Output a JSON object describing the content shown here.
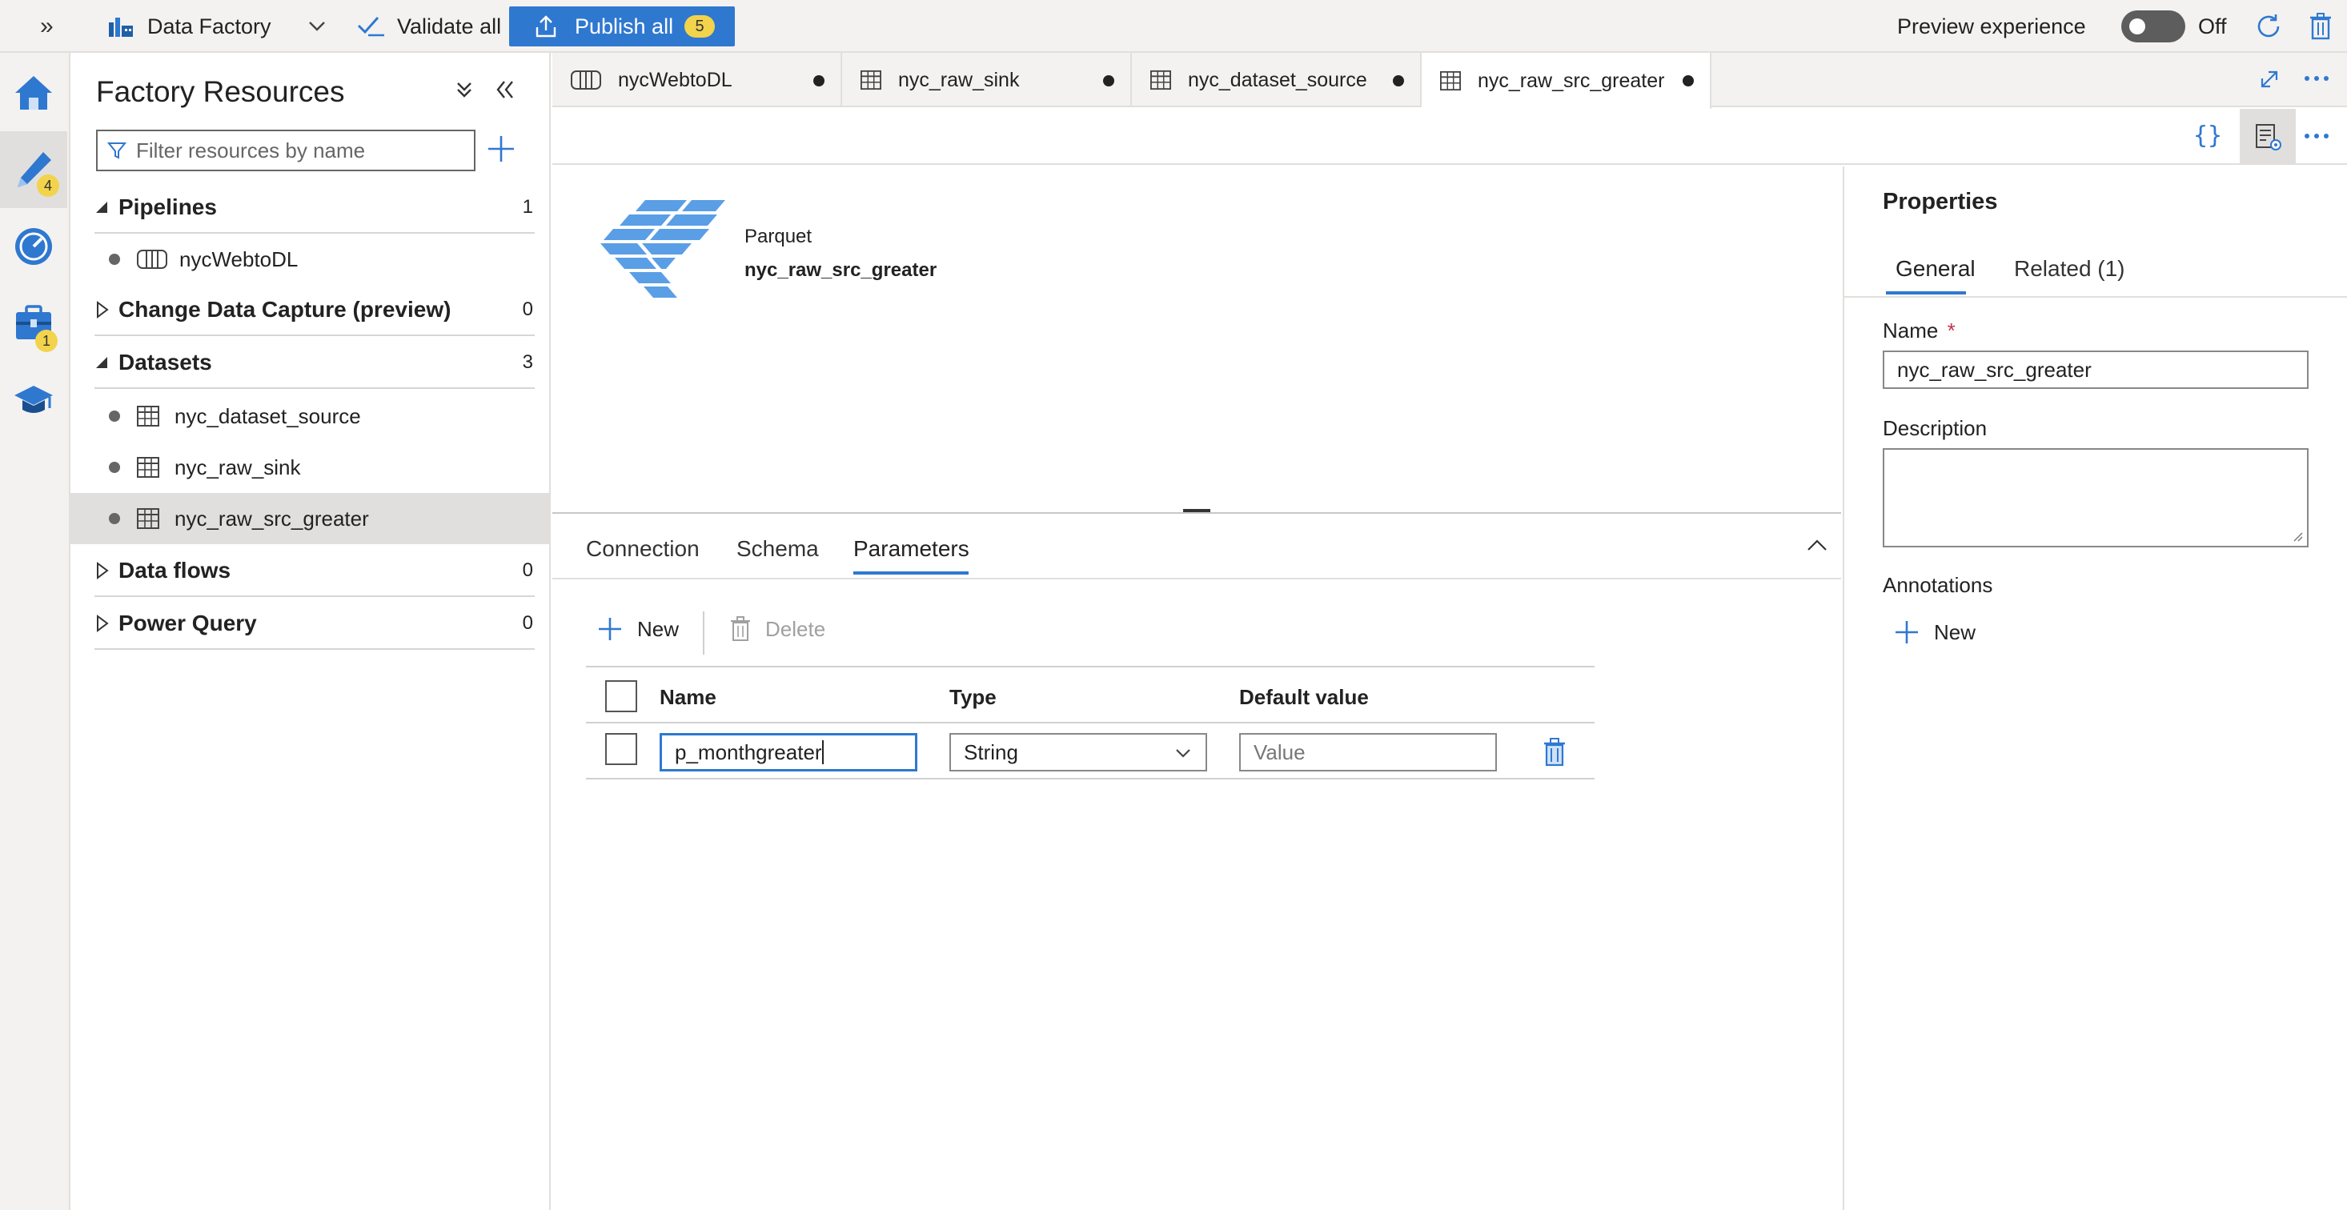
{
  "topbar": {
    "app_name": "Data Factory",
    "validate_label": "Validate all",
    "publish_label": "Publish all",
    "publish_count": "5",
    "preview_label": "Preview experience",
    "toggle_state": "Off"
  },
  "rail": {
    "author_badge": "4",
    "manage_badge": "1"
  },
  "resources": {
    "title": "Factory Resources",
    "filter_placeholder": "Filter resources by name",
    "sections": [
      {
        "label": "Pipelines",
        "count": "1"
      },
      {
        "label": "Change Data Capture (preview)",
        "count": "0"
      },
      {
        "label": "Datasets",
        "count": "3"
      },
      {
        "label": "Data flows",
        "count": "0"
      },
      {
        "label": "Power Query",
        "count": "0"
      }
    ],
    "pipelines": [
      "nycWebtoDL"
    ],
    "datasets": [
      "nyc_dataset_source",
      "nyc_raw_sink",
      "nyc_raw_src_greater"
    ]
  },
  "tabs": [
    {
      "label": "nycWebtoDL"
    },
    {
      "label": "nyc_raw_sink"
    },
    {
      "label": "nyc_dataset_source"
    },
    {
      "label": "nyc_raw_src_greater"
    }
  ],
  "canvas": {
    "format": "Parquet",
    "dataset_name": "nyc_raw_src_greater"
  },
  "bottom": {
    "tabs": [
      "Connection",
      "Schema",
      "Parameters"
    ],
    "new_label": "New",
    "delete_label": "Delete",
    "columns": {
      "name": "Name",
      "type": "Type",
      "default": "Default value"
    },
    "row": {
      "name": "p_monthgreater",
      "type": "String",
      "default_placeholder": "Value"
    }
  },
  "properties": {
    "title": "Properties",
    "tab_general": "General",
    "tab_related": "Related (1)",
    "name_label": "Name",
    "required_mark": "*",
    "name_value": "nyc_raw_src_greater",
    "description_label": "Description",
    "description_value": "",
    "annotations_label": "Annotations",
    "new_label": "New"
  },
  "colors": {
    "accent": "#2f78d0",
    "badge": "#f2d34b",
    "delete_icon": "#2f78d0"
  }
}
